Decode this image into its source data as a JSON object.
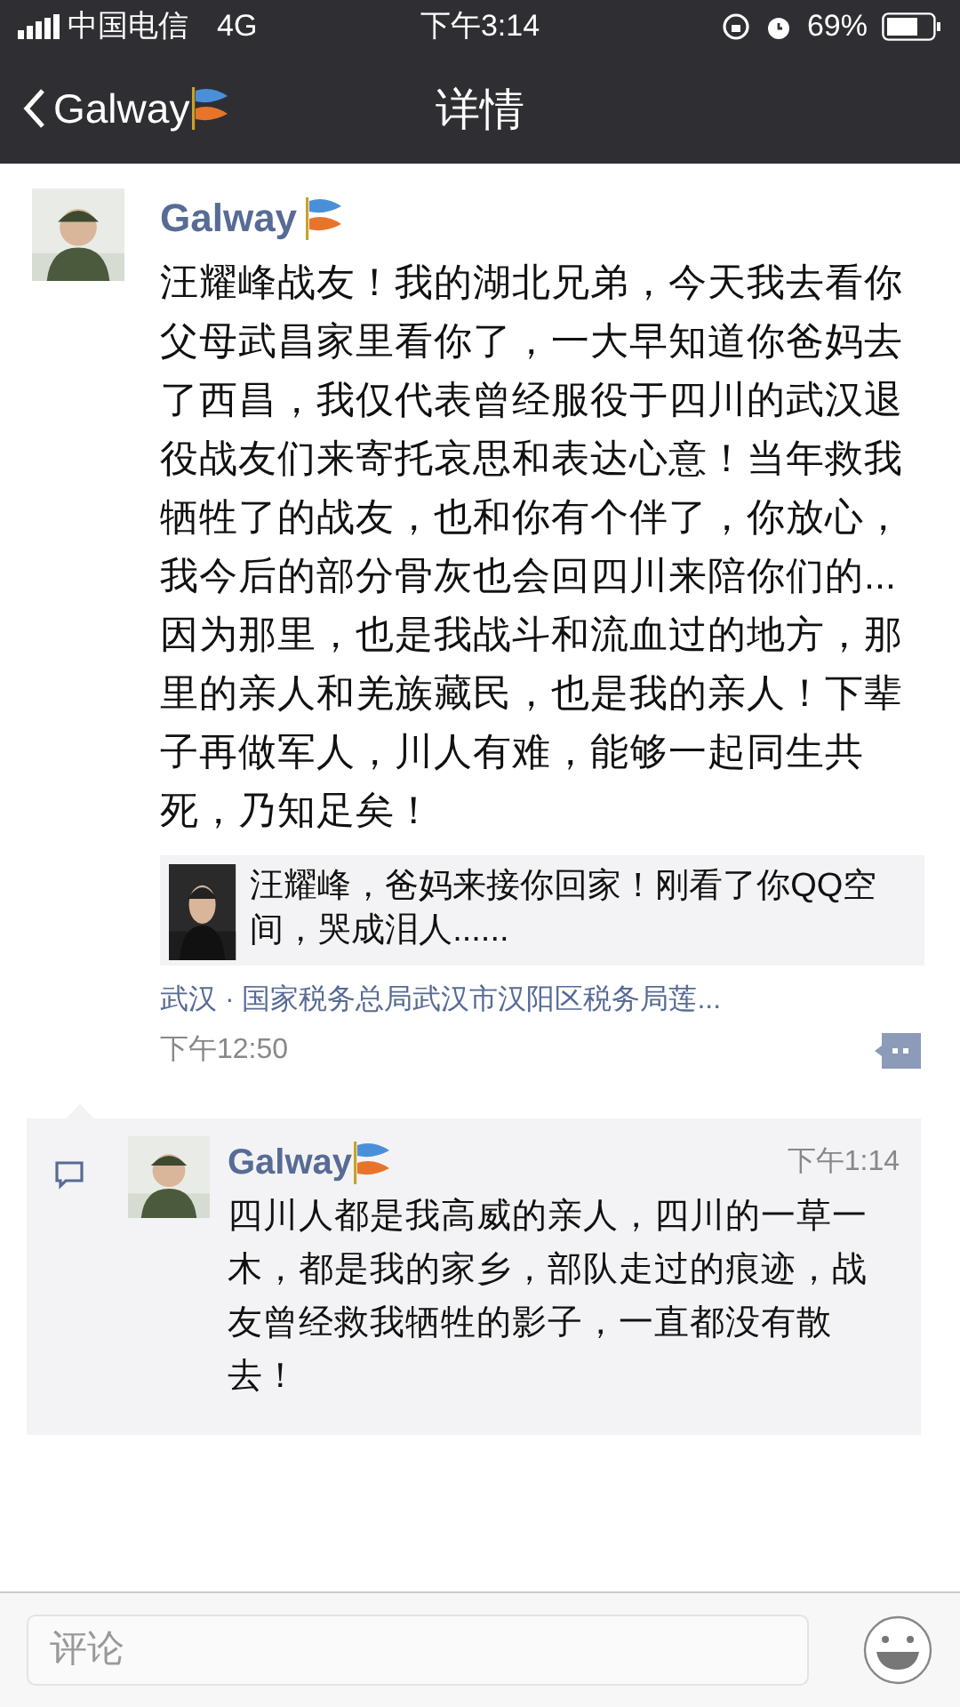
{
  "status_bar": {
    "carrier": "中国电信",
    "network": "4G",
    "time": "下午3:14",
    "battery": "69%"
  },
  "nav": {
    "back_label": "Galway",
    "title": "详情"
  },
  "post": {
    "author": "Galway",
    "text": "汪耀峰战友！我的湖北兄弟，今天我去看你父母武昌家里看你了，一大早知道你爸妈去了西昌，我仅代表曾经服役于四川的武汉退役战友们来寄托哀思和表达心意！当年救我牺牲了的战友，也和你有个伴了，你放心，我今后的部分骨灰也会回四川来陪你们的...因为那里，也是我战斗和流血过的地方，那里的亲人和羌族藏民，也是我的亲人！下辈子再做军人，川人有难，能够一起同生共死，乃知足矣！",
    "link": {
      "kind": "picture",
      "title": "汪耀峰，爸妈来接你回家！刚看了你QQ空间，哭成泪人......"
    },
    "location": "武汉 · 国家税务总局武汉市汉阳区税务局莲...",
    "time": "下午12:50"
  },
  "comments": [
    {
      "author": "Galway",
      "time": "下午1:14",
      "text": "四川人都是我高威的亲人，四川的一草一木，都是我的家乡，部队走过的痕迹，战友曾经救我牺牲的影子，一直都没有散去！"
    }
  ],
  "comment_bar": {
    "placeholder": "评论"
  }
}
